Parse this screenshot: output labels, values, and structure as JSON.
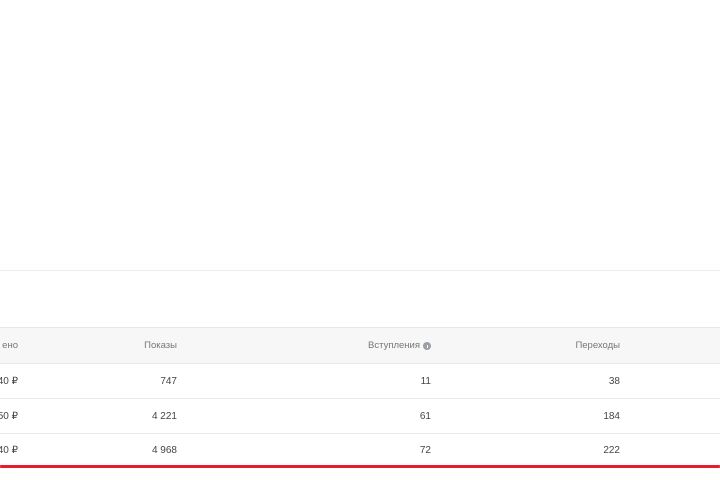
{
  "table": {
    "headers": {
      "spent": "ено",
      "shows": "Показы",
      "joins": "Вступления",
      "clicks": "Переходы"
    },
    "rows": [
      {
        "spent": "40 ₽",
        "shows": "747",
        "joins": "11",
        "clicks": "38"
      },
      {
        "spent": "50 ₽",
        "shows": "4 221",
        "joins": "61",
        "clicks": "184"
      },
      {
        "spent": "40 ₽",
        "shows": "4 968",
        "joins": "72",
        "clicks": "222"
      }
    ]
  },
  "colors": {
    "accent_underline": "#e41e2b",
    "header_bg": "#f7f7f7",
    "border": "#e8e8e8"
  },
  "icons": {
    "joins_header": "info-icon"
  }
}
